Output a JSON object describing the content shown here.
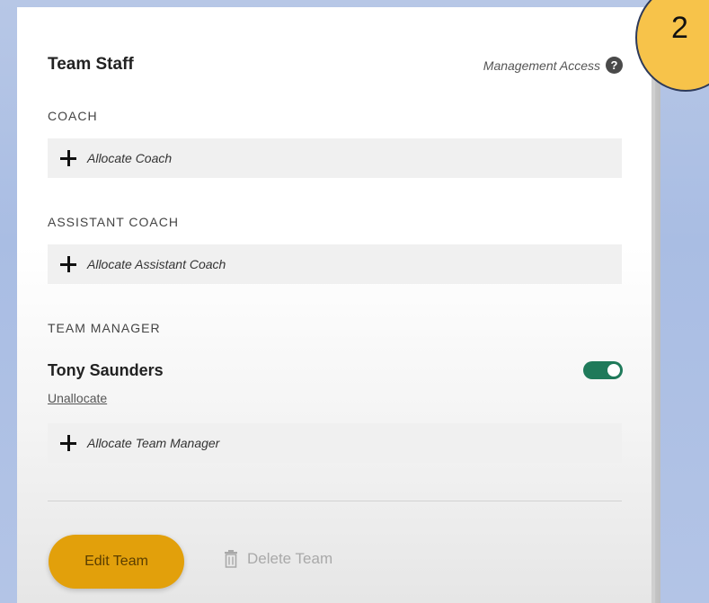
{
  "panel": {
    "title": "Team Staff",
    "management_access": "Management Access",
    "help_icon": "question-circle-icon"
  },
  "sections": {
    "coach": {
      "label": "COACH",
      "allocate": "Allocate Coach"
    },
    "assistant_coach": {
      "label": "ASSISTANT COACH",
      "allocate": "Allocate Assistant Coach"
    },
    "team_manager": {
      "label": "TEAM MANAGER",
      "person": "Tony Saunders",
      "unallocate": "Unallocate",
      "toggle_on": true,
      "allocate": "Allocate Team Manager"
    }
  },
  "actions": {
    "edit": "Edit Team",
    "delete": "Delete Team"
  },
  "badge": {
    "number": "2"
  },
  "colors": {
    "accent": "#e2a00b",
    "toggle": "#1f7a5a",
    "badge": "#f7c34a"
  }
}
